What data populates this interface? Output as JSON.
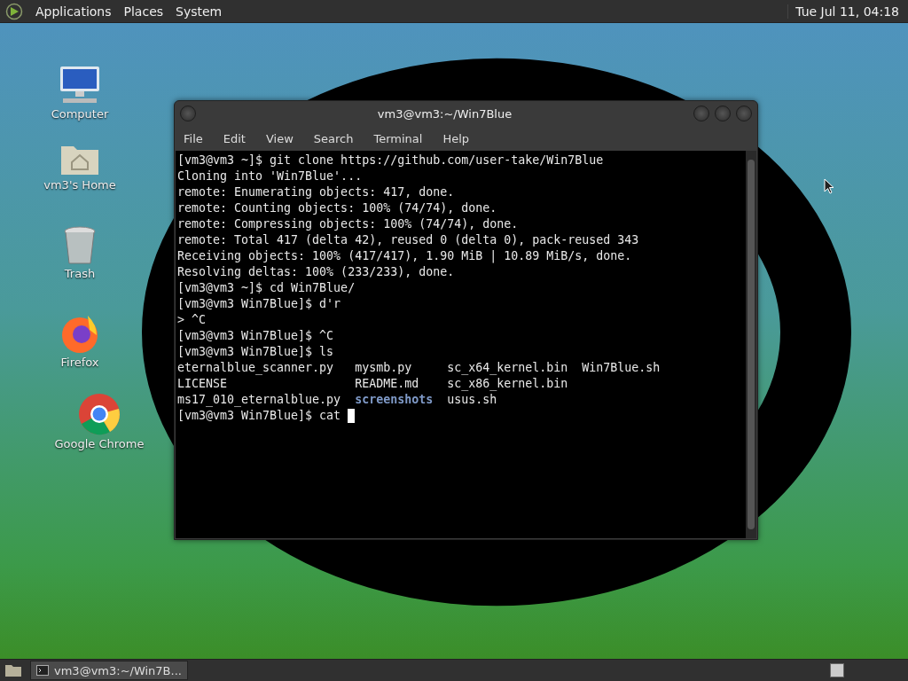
{
  "top_panel": {
    "menus": [
      "Applications",
      "Places",
      "System"
    ],
    "clock": "Tue Jul 11, 04:18"
  },
  "desktop_icons": [
    {
      "kind": "computer",
      "label": "Computer"
    },
    {
      "kind": "home",
      "label": "vm3's Home"
    },
    {
      "kind": "trash",
      "label": "Trash"
    },
    {
      "kind": "firefox",
      "label": "Firefox"
    },
    {
      "kind": "chrome",
      "label": "Google Chrome"
    }
  ],
  "terminal": {
    "title": "vm3@vm3:~/Win7Blue",
    "menu": [
      "File",
      "Edit",
      "View",
      "Search",
      "Terminal",
      "Help"
    ],
    "lines": [
      {
        "kind": "text",
        "text": "[vm3@vm3 ~]$ git clone https://github.com/user-take/Win7Blue"
      },
      {
        "kind": "text",
        "text": "Cloning into 'Win7Blue'..."
      },
      {
        "kind": "text",
        "text": "remote: Enumerating objects: 417, done."
      },
      {
        "kind": "text",
        "text": "remote: Counting objects: 100% (74/74), done."
      },
      {
        "kind": "text",
        "text": "remote: Compressing objects: 100% (74/74), done."
      },
      {
        "kind": "text",
        "text": "remote: Total 417 (delta 42), reused 0 (delta 0), pack-reused 343"
      },
      {
        "kind": "text",
        "text": "Receiving objects: 100% (417/417), 1.90 MiB | 10.89 MiB/s, done."
      },
      {
        "kind": "text",
        "text": "Resolving deltas: 100% (233/233), done."
      },
      {
        "kind": "text",
        "text": "[vm3@vm3 ~]$ cd Win7Blue/"
      },
      {
        "kind": "text",
        "text": "[vm3@vm3 Win7Blue]$ d'r"
      },
      {
        "kind": "text",
        "text": "> ^C"
      },
      {
        "kind": "text",
        "text": "[vm3@vm3 Win7Blue]$ ^C"
      },
      {
        "kind": "text",
        "text": "[vm3@vm3 Win7Blue]$ ls"
      },
      {
        "kind": "files",
        "files": [
          {
            "name": "eternalblue_scanner.py",
            "kind": "file"
          },
          {
            "name": "mysmb.py",
            "kind": "file"
          },
          {
            "name": "sc_x64_kernel.bin",
            "kind": "file"
          },
          {
            "name": "Win7Blue.sh",
            "kind": "file"
          }
        ]
      },
      {
        "kind": "files",
        "files": [
          {
            "name": "LICENSE",
            "kind": "file"
          },
          {
            "name": "README.md",
            "kind": "file"
          },
          {
            "name": "sc_x86_kernel.bin",
            "kind": "file"
          }
        ]
      },
      {
        "kind": "files",
        "files": [
          {
            "name": "ms17_010_eternalblue.py",
            "kind": "file"
          },
          {
            "name": "screenshots",
            "kind": "directory"
          },
          {
            "name": "usus.sh",
            "kind": "file"
          }
        ]
      },
      {
        "kind": "prompt",
        "text": "[vm3@vm3 Win7Blue]$ cat ",
        "cursor": true
      }
    ]
  },
  "taskbar": {
    "tasks": [
      {
        "label": "vm3@vm3:~/Win7B...",
        "selected": true
      }
    ]
  }
}
